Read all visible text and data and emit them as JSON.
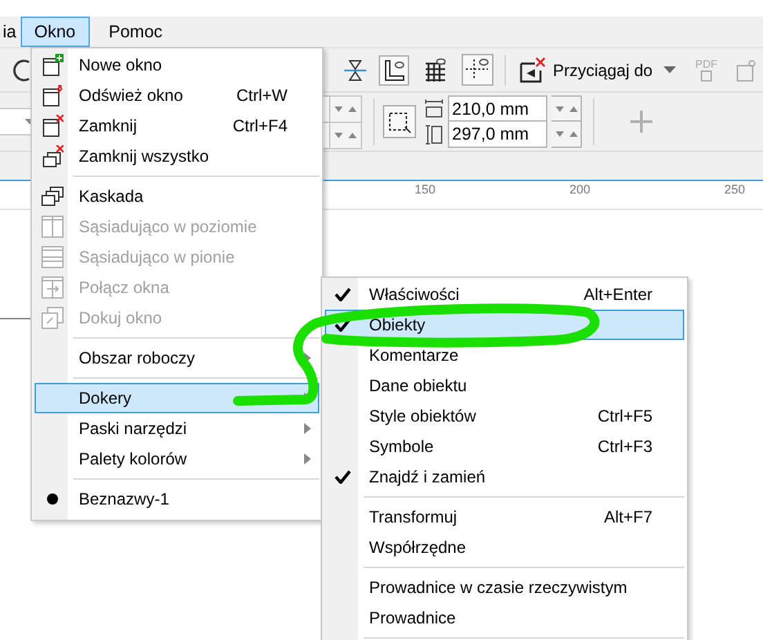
{
  "menubar": [
    {
      "label": "ia",
      "selected": false
    },
    {
      "label": "Okno",
      "selected": true
    },
    {
      "label": "Pomoc",
      "selected": false
    }
  ],
  "toolbar": {
    "snap_button": "Przyciągaj do",
    "pdf_label": "PDF"
  },
  "page_size": {
    "width": "210,0 mm",
    "height": "297,0 mm"
  },
  "ruler": {
    "labels": [
      "150",
      "200",
      "250"
    ]
  },
  "window_menu": {
    "items": [
      {
        "kind": "item",
        "label": "Nowe okno",
        "disabled": false,
        "selected": false,
        "submenu": false,
        "checked": false
      },
      {
        "kind": "item",
        "label": "Odśwież okno",
        "shortcut": "Ctrl+W",
        "disabled": false,
        "selected": false,
        "submenu": false,
        "checked": false
      },
      {
        "kind": "item",
        "label": "Zamknij",
        "shortcut": "Ctrl+F4",
        "disabled": false,
        "selected": false,
        "submenu": false,
        "checked": false
      },
      {
        "kind": "item",
        "label": "Zamknij wszystko",
        "disabled": false,
        "selected": false,
        "submenu": false,
        "checked": false
      },
      {
        "kind": "separator"
      },
      {
        "kind": "item",
        "label": "Kaskada",
        "disabled": false,
        "selected": false,
        "submenu": false,
        "checked": false
      },
      {
        "kind": "item",
        "label": "Sąsiadująco w poziomie",
        "disabled": true,
        "selected": false,
        "submenu": false,
        "checked": false
      },
      {
        "kind": "item",
        "label": "Sąsiadująco w pionie",
        "disabled": true,
        "selected": false,
        "submenu": false,
        "checked": false
      },
      {
        "kind": "item",
        "label": "Połącz okna",
        "disabled": true,
        "selected": false,
        "submenu": false,
        "checked": false
      },
      {
        "kind": "item",
        "label": "Dokuj okno",
        "disabled": true,
        "selected": false,
        "submenu": false,
        "checked": false
      },
      {
        "kind": "separator"
      },
      {
        "kind": "item",
        "label": "Obszar roboczy",
        "disabled": false,
        "selected": false,
        "submenu": true,
        "checked": false
      },
      {
        "kind": "separator"
      },
      {
        "kind": "item",
        "label": "Dokery",
        "disabled": false,
        "selected": true,
        "submenu": true,
        "checked": false
      },
      {
        "kind": "item",
        "label": "Paski narzędzi",
        "disabled": false,
        "selected": false,
        "submenu": true,
        "checked": false
      },
      {
        "kind": "item",
        "label": "Palety kolorów",
        "disabled": false,
        "selected": false,
        "submenu": true,
        "checked": false
      },
      {
        "kind": "separator"
      },
      {
        "kind": "item",
        "label": "Beznazwy-1",
        "disabled": false,
        "selected": false,
        "submenu": false,
        "checked": true
      }
    ]
  },
  "dockers_submenu": {
    "items": [
      {
        "kind": "item",
        "label": "Właściwości",
        "shortcut": "Alt+Enter",
        "disabled": false,
        "selected": false,
        "submenu": false,
        "checked": true
      },
      {
        "kind": "item",
        "label": "Obiekty",
        "disabled": false,
        "selected": true,
        "submenu": false,
        "checked": true
      },
      {
        "kind": "item",
        "label": "Komentarze",
        "disabled": false,
        "selected": false,
        "submenu": false,
        "checked": false
      },
      {
        "kind": "item",
        "label": "Dane obiektu",
        "disabled": false,
        "selected": false,
        "submenu": false,
        "checked": false
      },
      {
        "kind": "item",
        "label": "Style obiektów",
        "shortcut": "Ctrl+F5",
        "disabled": false,
        "selected": false,
        "submenu": false,
        "checked": false
      },
      {
        "kind": "item",
        "label": "Symbole",
        "shortcut": "Ctrl+F3",
        "disabled": false,
        "selected": false,
        "submenu": false,
        "checked": false
      },
      {
        "kind": "item",
        "label": "Znajdź i zamień",
        "disabled": false,
        "selected": false,
        "submenu": false,
        "checked": true
      },
      {
        "kind": "separator"
      },
      {
        "kind": "item",
        "label": "Transformuj",
        "shortcut": "Alt+F7",
        "disabled": false,
        "selected": false,
        "submenu": false,
        "checked": false
      },
      {
        "kind": "item",
        "label": "Współrzędne",
        "disabled": false,
        "selected": false,
        "submenu": false,
        "checked": false
      },
      {
        "kind": "separator"
      },
      {
        "kind": "item",
        "label": "Prowadnice w czasie rzeczywistym",
        "disabled": false,
        "selected": false,
        "submenu": false,
        "checked": false
      },
      {
        "kind": "item",
        "label": "Prowadnice",
        "disabled": false,
        "selected": false,
        "submenu": false,
        "checked": false
      },
      {
        "kind": "separator"
      }
    ]
  }
}
